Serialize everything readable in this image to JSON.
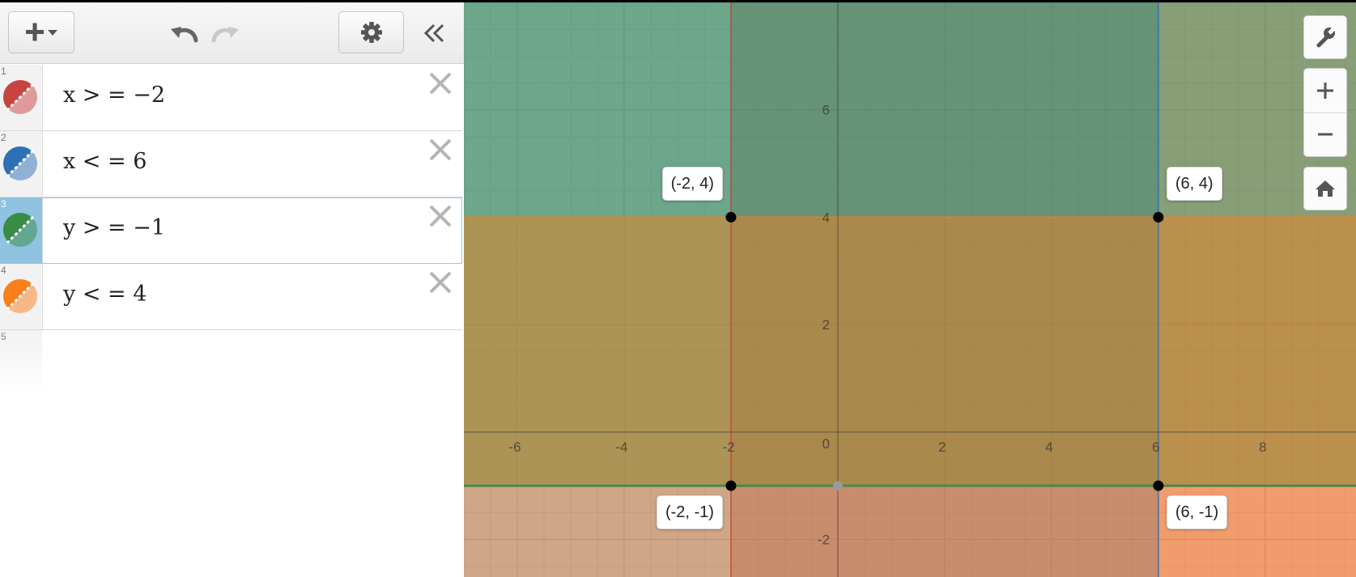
{
  "expressions": [
    {
      "index": "1",
      "formula": "x > = −2",
      "color": "#c74440"
    },
    {
      "index": "2",
      "formula": "x < = 6",
      "color": "#2d70b3"
    },
    {
      "index": "3",
      "formula": "y > = −1",
      "color": "#388c46",
      "active": true
    },
    {
      "index": "4",
      "formula": "y < = 4",
      "color": "#fa7e19"
    },
    {
      "index": "5",
      "formula": ""
    }
  ],
  "graph": {
    "x_tick_labels": [
      "-6",
      "-4",
      "-2",
      "2",
      "4",
      "6",
      "8"
    ],
    "y_tick_labels": [
      "6",
      "4",
      "2",
      "-2"
    ],
    "origin_label": "0",
    "points": [
      {
        "label": "(-2, 4)",
        "x": -2,
        "y": 4
      },
      {
        "label": "(6, 4)",
        "x": 6,
        "y": 4
      },
      {
        "label": "(-2, -1)",
        "x": -2,
        "y": -1
      },
      {
        "label": "(6, -1)",
        "x": 6,
        "y": -1
      }
    ],
    "regions": {
      "x_ge": -2,
      "x_le": 6,
      "y_ge": -1,
      "y_le": 4
    },
    "x_range": [
      -7,
      9.7
    ],
    "y_range": [
      -2.7,
      8
    ]
  },
  "icons": {
    "add": "plus-dropdown-icon",
    "undo": "undo-icon",
    "redo": "redo-icon",
    "settings": "gear-icon",
    "collapse": "double-chevron-left-icon",
    "wrench": "wrench-icon",
    "zoom_in": "plus-icon",
    "zoom_out": "minus-icon",
    "home": "home-icon"
  }
}
